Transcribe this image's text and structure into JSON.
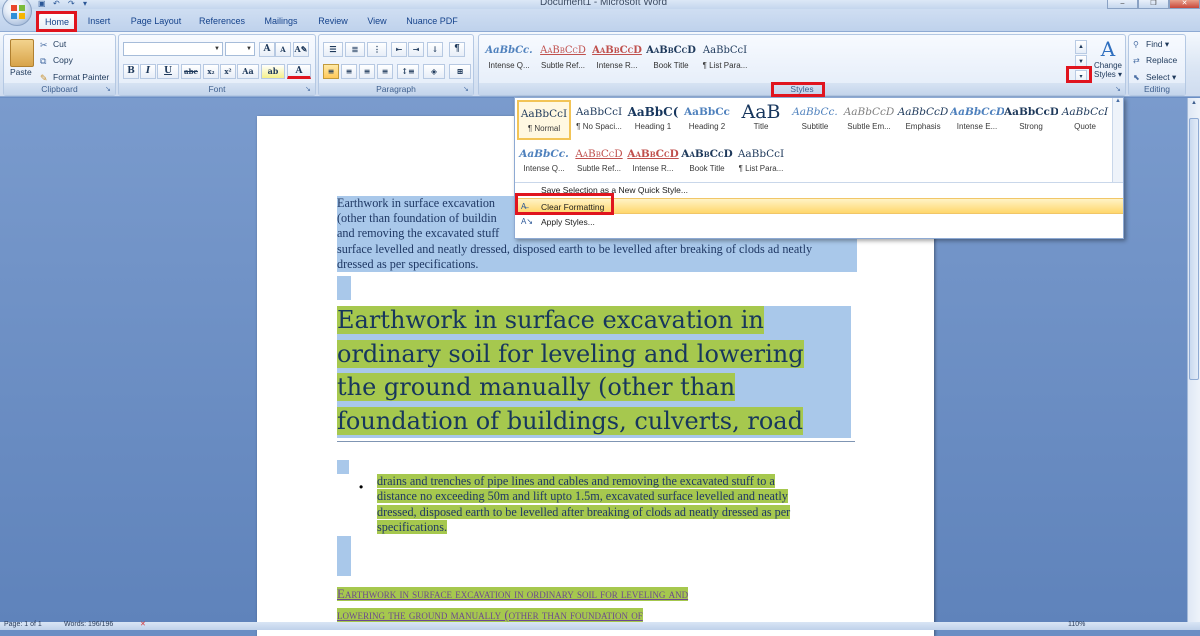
{
  "window": {
    "title": "Document1 - Microsoft Word",
    "buttons": [
      "–",
      "❐",
      "✕"
    ]
  },
  "tabs": [
    "Home",
    "Insert",
    "Page Layout",
    "References",
    "Mailings",
    "Review",
    "View",
    "Nuance PDF"
  ],
  "active_tab": "Home",
  "ribbon": {
    "clipboard": {
      "paste": "Paste",
      "cut": "Cut",
      "copy": "Copy",
      "format_painter": "Format Painter",
      "label": "Clipboard"
    },
    "font": {
      "font_name": "",
      "font_size": "",
      "grow": "A",
      "shrink": "A",
      "bold": "B",
      "italic": "I",
      "underline": "U",
      "strike": "abe",
      "subscript": "x₂",
      "superscript": "x²",
      "change_case": "Aa",
      "highlight": "ab",
      "font_color": "A",
      "label": "Font"
    },
    "paragraph": {
      "label": "Paragraph",
      "show_marks": "¶"
    },
    "styles": {
      "label": "Styles",
      "gallery": [
        {
          "sample": "AaBbCc.",
          "name": "Intense Q..."
        },
        {
          "sample": "AaBbCcD",
          "name": "Subtle Ref..."
        },
        {
          "sample": "AaBbCcD",
          "name": "Intense R..."
        },
        {
          "sample": "AaBbCcD",
          "name": "Book Title"
        },
        {
          "sample": "AaBbCcI",
          "name": "¶ List Para..."
        }
      ],
      "change_styles_line1": "Change",
      "change_styles_line2": "Styles ▾"
    },
    "editing": {
      "label": "Editing",
      "find": "Find ▾",
      "replace": "Replace",
      "select": "Select ▾"
    }
  },
  "styles_dropdown": {
    "row1": [
      {
        "sample": "AaBbCcI",
        "name": "¶ Normal"
      },
      {
        "sample": "AaBbCcI",
        "name": "¶ No Spaci..."
      },
      {
        "sample": "AaBbC(",
        "name": "Heading 1"
      },
      {
        "sample": "AaBbCc",
        "name": "Heading 2"
      },
      {
        "sample": "AaB",
        "name": "Title"
      },
      {
        "sample": "AaBbCc.",
        "name": "Subtitle"
      },
      {
        "sample": "AaBbCcD",
        "name": "Subtle Em..."
      },
      {
        "sample": "AaBbCcD",
        "name": "Emphasis"
      },
      {
        "sample": "AaBbCcD",
        "name": "Intense E..."
      },
      {
        "sample": "AaBbCcD",
        "name": "Strong"
      },
      {
        "sample": "AaBbCcI",
        "name": "Quote"
      }
    ],
    "row2": [
      {
        "sample": "AaBbCc.",
        "name": "Intense Q..."
      },
      {
        "sample": "AaBbCcD",
        "name": "Subtle Ref..."
      },
      {
        "sample": "AaBbCcD",
        "name": "Intense R..."
      },
      {
        "sample": "AaBbCcD",
        "name": "Book Title"
      },
      {
        "sample": "AaBbCcI",
        "name": "¶ List Para..."
      }
    ],
    "menu": {
      "save_selection": "Save Selection as a New Quick Style...",
      "clear_formatting": "Clear Formatting",
      "apply_styles": "Apply Styles..."
    }
  },
  "document": {
    "para1_lines": [
      "Earthwork in surface excavation",
      "(other than foundation of buildin",
      "and removing the excavated stuff",
      "surface levelled and neatly dressed, disposed earth to be levelled after breaking of clods ad neatly",
      "dressed as per specifications."
    ],
    "heading_lines": [
      "Earthwork in surface excavation in",
      "ordinary soil for leveling and lowering",
      "the ground manually (other than",
      "foundation of buildings, culverts, road"
    ],
    "bullet_lines": [
      "drains and trenches of pipe lines and cables and removing the excavated stuff to a",
      "distance no exceeding 50m and lift upto 1.5m, excavated surface levelled and neatly",
      "dressed, disposed earth to be levelled after breaking of clods ad neatly dressed as per",
      "specifications."
    ],
    "caps_lines": [
      "Earthwork in surface excavation in ordinary soil for leveling and",
      "lowering the ground manually (other than foundation of"
    ]
  },
  "statusbar": {
    "page": "Page: 1 of 1",
    "words": "Words: 196/196",
    "zoom": "110%"
  },
  "colors": {
    "highlight_green": "#a6c84e",
    "selection_blue": "#a9c8ea",
    "annotation_red": "#e0141e"
  }
}
